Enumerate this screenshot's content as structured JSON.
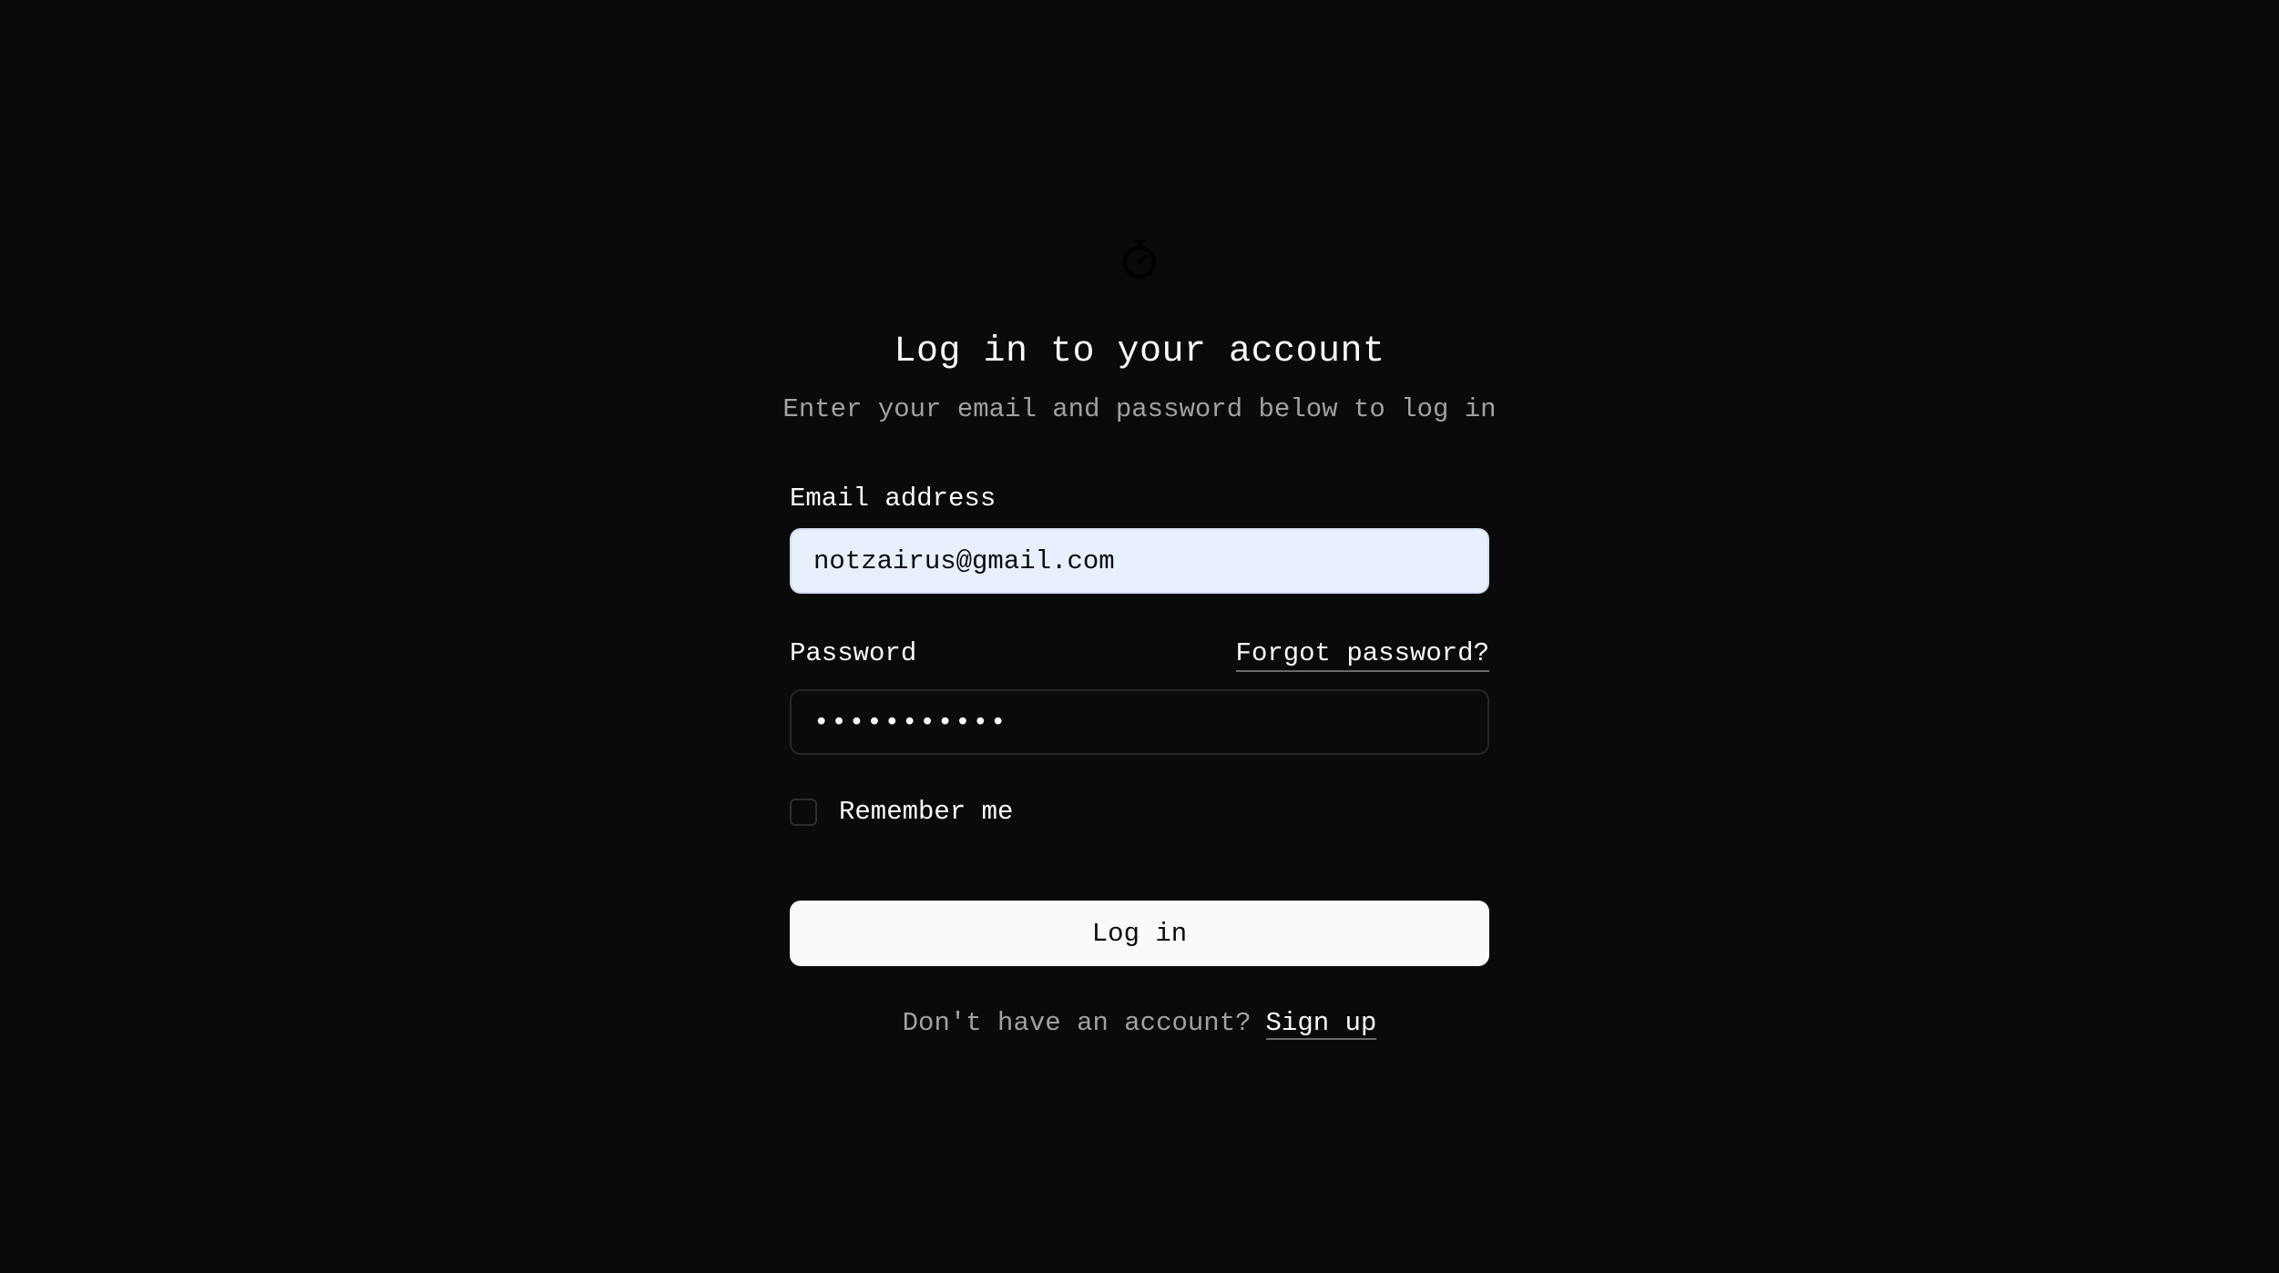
{
  "header": {
    "logo_icon": "stopwatch-icon",
    "title": "Log in to your account",
    "subtitle": "Enter your email and password below to log in"
  },
  "form": {
    "email_label": "Email address",
    "email_value": "notzairus@gmail.com",
    "password_label": "Password",
    "forgot_password_label": "Forgot password?",
    "password_value": "•••••••••••",
    "remember_label": "Remember me",
    "remember_checked": false,
    "submit_label": "Log in"
  },
  "footer": {
    "signup_prompt": "Don't have an account?",
    "signup_label": "Sign up"
  },
  "colors": {
    "background": "#0a0a0a",
    "foreground": "#fafafa",
    "muted": "#a1a1a1",
    "autofill": "#e8effd"
  }
}
